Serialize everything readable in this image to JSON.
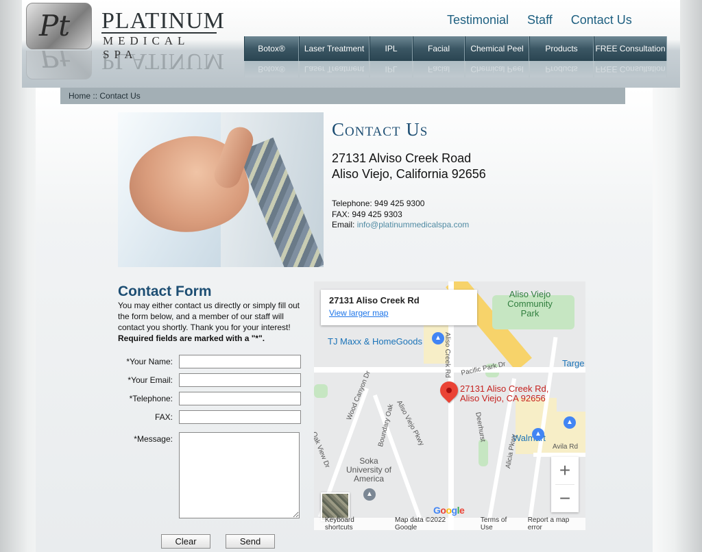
{
  "brand": {
    "name": "PLATINUM",
    "sub": "MEDICAL SPA",
    "mark": "Pt"
  },
  "top_links": [
    "Testimonial",
    "Staff",
    "Contact Us"
  ],
  "nav": [
    {
      "label": "Botox®"
    },
    {
      "label": "Laser Treatment"
    },
    {
      "label": "IPL"
    },
    {
      "label": "Facial"
    },
    {
      "label": "Chemical Peel"
    },
    {
      "label": "Products"
    },
    {
      "label": "FREE Consultation"
    }
  ],
  "breadcrumb": {
    "home": "Home",
    "separator": "::",
    "current": "Contact Us"
  },
  "contact": {
    "title": "Contact Us",
    "address_line1": "27131 Alviso Creek Road",
    "address_line2": "Aliso Viejo, California 92656",
    "telephone": "Telephone: 949 425 9300",
    "fax": "FAX: 949 425 9303",
    "email_label": "Email:",
    "email": "info@platinummedicalspa.com"
  },
  "form": {
    "title": "Contact Form",
    "intro": "You may either contact us directly or simply fill out the form below, and a member of our staff will contact you shortly. Thank you for your interest!",
    "required_note": "Required fields are marked with a \"*\".",
    "fields": {
      "name": "*Your Name:",
      "email": "*Your Email:",
      "telephone": "*Telephone:",
      "fax": "FAX:",
      "message": "*Message:"
    },
    "clear_label": "Clear",
    "send_label": "Send"
  },
  "map": {
    "card_title": "27131 Aliso Creek Rd",
    "card_link": "View larger map",
    "pin_label_1": "27131 Aliso Creek Rd,",
    "pin_label_2": "Aliso Viejo, CA 92656",
    "labels": {
      "park": "Aliso Viejo Community Park",
      "tjmaxx": "TJ Maxx & HomeGoods",
      "walmart": "Walmart",
      "target": "Targe",
      "soka": "Soka University of America",
      "pacific": "Pacific Park Dr",
      "aliso_creek": "Aliso Creek Rd",
      "wood_canyon": "Wood Canyon Dr",
      "boundary_oak": "Boundary Oak",
      "aliso_viejo_pkwy": "Aliso Viejo Pkwy",
      "deerhurst": "Deerhurst",
      "avila": "Avila Rd",
      "oak_view": "Oak View Dr",
      "alicia": "Alicia Pkwy"
    },
    "footer": [
      "Keyboard shortcuts",
      "Map data ©2022 Google",
      "Terms of Use",
      "Report a map error"
    ],
    "google": [
      "G",
      "o",
      "o",
      "g",
      "l",
      "e"
    ]
  }
}
